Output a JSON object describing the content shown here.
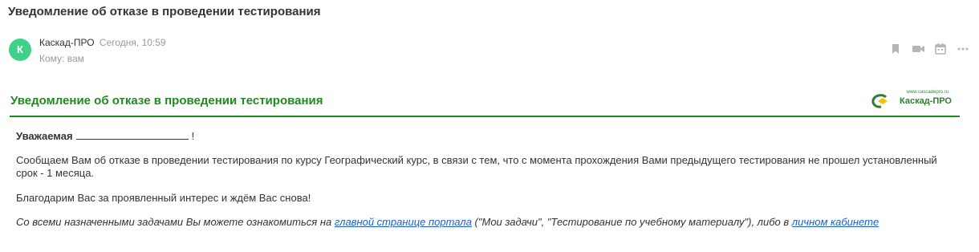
{
  "email": {
    "subject": "Уведомление об отказе в проведении тестирования",
    "avatar_letter": "К",
    "sender_name": "Каскад-ПРО",
    "date": "Сегодня, 10:59",
    "to": "Кому: вам"
  },
  "actions": {
    "icons": [
      "bookmark-icon",
      "video-icon",
      "calendar-icon",
      "more-icon"
    ]
  },
  "content": {
    "banner_title": "Уведомление об отказе в проведении тестирования",
    "logo_url": "www.cascadepro.ru",
    "logo_text": "Каскад-ПРО",
    "greeting": "Уважаемая",
    "greeting_end": "!",
    "paragraph1": "Сообщаем Вам об отказе в проведении тестирования по курсу Географический курс, в связи с тем, что с момента прохождения Вами предыдущего тестирования не прошел установленный срок - 1 месяца.",
    "paragraph2": "Благодарим Вас за проявленный интерес и ждём Вас снова!",
    "paragraph3_start": "Со всеми назначенными задачами Вы можете ознакомиться на ",
    "link1": "главной странице портала",
    "paragraph3_middle": " (\"Мои задачи\", \"Тестирование по учебному материалу\"), либо в ",
    "link2": "личном кабинете"
  },
  "colors": {
    "accent_green": "#1f8a1f",
    "avatar_green": "#3fd08a",
    "link_blue": "#1a5fd1"
  }
}
